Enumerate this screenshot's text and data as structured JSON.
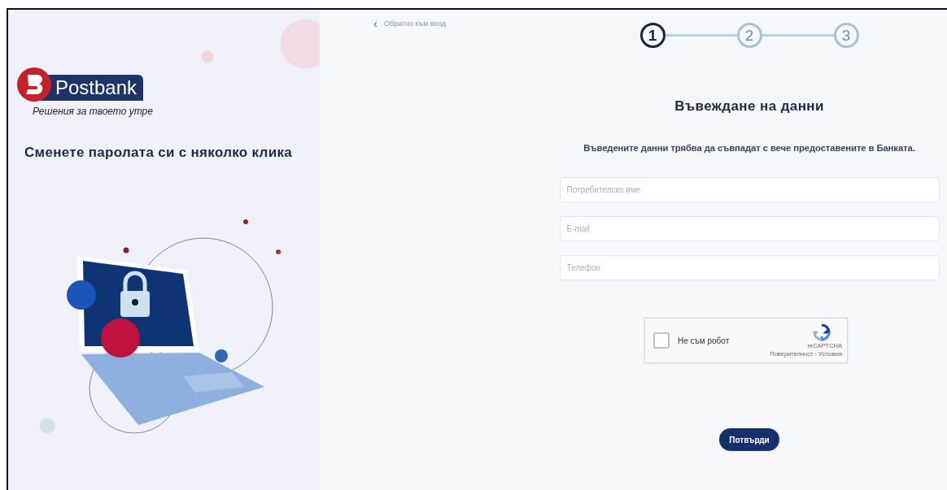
{
  "brand": {
    "name": "Postbank",
    "tagline": "Решения за твоето утре"
  },
  "side": {
    "heading": "Сменете паролата си с няколко клика"
  },
  "back_link": {
    "icon": "‹",
    "label": "Обратно към вход"
  },
  "steps": [
    {
      "label": "1",
      "selected": true
    },
    {
      "label": "2",
      "selected": false
    },
    {
      "label": "3",
      "selected": false
    }
  ],
  "form": {
    "title": "Въвеждане на данни",
    "note": "Въведените данни трябва да съвпадат с вече предоставените в Банката.",
    "fields": [
      {
        "placeholder": "Потребителско име"
      },
      {
        "placeholder": "E-mail"
      },
      {
        "placeholder": "Телефон"
      }
    ],
    "captcha": {
      "label": "Не съм робот",
      "checked": false,
      "brand": "reCAPTCHA",
      "links": "Поверителност - Условия"
    },
    "submit": "Потвърди"
  }
}
